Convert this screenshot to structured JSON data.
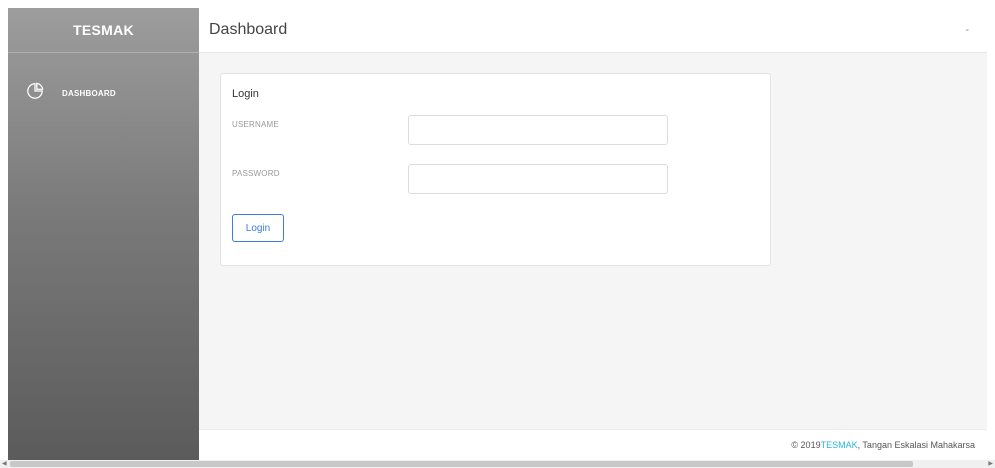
{
  "sidebar": {
    "brand": "TESMAK",
    "items": [
      {
        "icon": "pie-chart-icon",
        "label": "DASHBOARD"
      }
    ]
  },
  "header": {
    "title": "Dashboard",
    "menu_caret": "-"
  },
  "login_card": {
    "title": "Login",
    "username_label": "USERNAME",
    "username_value": "",
    "password_label": "PASSWORD",
    "password_value": "",
    "submit_label": "Login"
  },
  "footer": {
    "prefix": "© 2019 ",
    "brand": "TESMAK",
    "suffix": ", Tangan Eskalasi Mahakarsa"
  },
  "colors": {
    "accent": "#3d7de0",
    "footer_link": "#29b6d8",
    "sidebar_top": "#9d9d9d",
    "sidebar_bottom": "#5b5b5b"
  }
}
